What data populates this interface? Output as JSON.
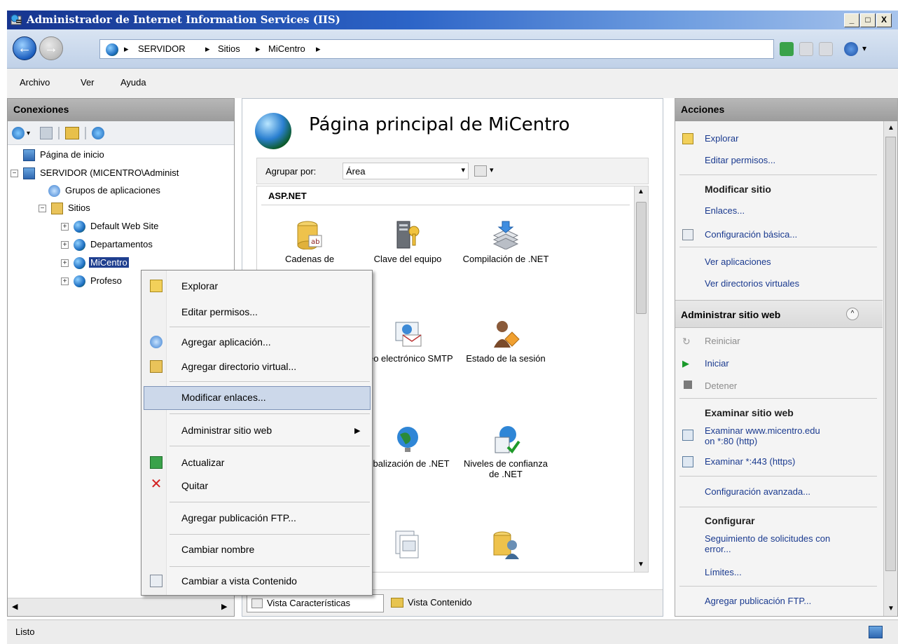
{
  "window": {
    "title": "Administrador de Internet Information Services (IIS)",
    "controls": {
      "minimize": "_",
      "maximize": "□",
      "close": "X"
    }
  },
  "address": {
    "crumbs": [
      "SERVIDOR",
      "Sitios",
      "MiCentro"
    ]
  },
  "menu": {
    "items": [
      "Archivo",
      "Ver",
      "Ayuda"
    ]
  },
  "connections": {
    "header": "Conexiones",
    "tree": {
      "start": "Página de inicio",
      "server": "SERVIDOR (MICENTRO\\Administ",
      "app_pools": "Grupos de aplicaciones",
      "sites": "Sitios",
      "site1": "Default Web Site",
      "site2": "Departamentos",
      "site3": "MiCentro",
      "site4": "Profeso"
    }
  },
  "center": {
    "title": "Página principal de MiCentro",
    "group_label": "Agrupar por:",
    "group_value": "Área",
    "section": "ASP.NET",
    "features": [
      {
        "label": "Cadenas de"
      },
      {
        "label": "Clave del equipo"
      },
      {
        "label": "Compilación de .NET"
      },
      {
        "label": "rreo electrónico SMTP"
      },
      {
        "label": "Estado de la sesión"
      },
      {
        "label": "lobalización de .NET"
      },
      {
        "label": "Niveles de confianza de .NET"
      }
    ],
    "view_features": "Vista Características",
    "view_content": "Vista Contenido"
  },
  "actions": {
    "header": "Acciones",
    "explore": "Explorar",
    "edit_perms": "Editar permisos...",
    "edit_site_head": "Modificar sitio",
    "bindings": "Enlaces...",
    "basic_settings": "Configuración básica...",
    "view_apps": "Ver aplicaciones",
    "view_vdirs": "Ver directorios virtuales",
    "manage_head": "Administrar sitio web",
    "restart": "Reiniciar",
    "start": "Iniciar",
    "stop": "Detener",
    "browse_head": "Examinar sitio web",
    "browse1": "Examinar www.micentro.edu",
    "browse1b": "on *:80 (http)",
    "browse2": "Examinar *:443 (https)",
    "advanced": "Configuración avanzada...",
    "configure_head": "Configurar",
    "failed_req": "Seguimiento de solicitudes con",
    "failed_req2": "error...",
    "limits": "Límites...",
    "add_ftp": "Agregar publicación FTP..."
  },
  "context_menu": {
    "explore": "Explorar",
    "edit_perms": "Editar permisos...",
    "add_app": "Agregar aplicación...",
    "add_vdir": "Agregar directorio virtual...",
    "edit_bindings": "Modificar enlaces...",
    "manage": "Administrar sitio web",
    "refresh": "Actualizar",
    "remove": "Quitar",
    "add_ftp": "Agregar publicación FTP...",
    "rename": "Cambiar nombre",
    "switch_content": "Cambiar a vista Contenido"
  },
  "status": {
    "text": "Listo"
  }
}
